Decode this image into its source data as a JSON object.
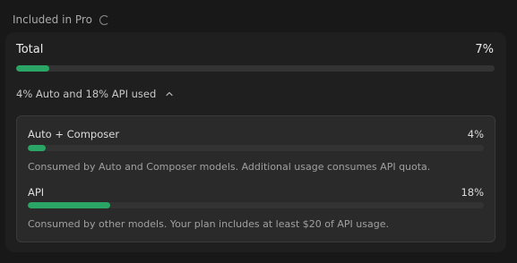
{
  "header": {
    "title": "Included in Pro"
  },
  "total": {
    "label": "Total",
    "percent_label": "7%",
    "progress": 0.07
  },
  "breakdown": {
    "toggle_label": "4% Auto and 18% API used",
    "expanded": true,
    "items": [
      {
        "label": "Auto + Composer",
        "percent_label": "4%",
        "progress": 0.04,
        "description": "Consumed by Auto and Composer models. Additional usage consumes API quota."
      },
      {
        "label": "API",
        "percent_label": "18%",
        "progress": 0.18,
        "description": "Consumed by other models. Your plan includes at least $20 of API usage."
      }
    ]
  },
  "colors": {
    "accent": "#2aa565",
    "track": "#333333",
    "background": "#181818",
    "card": "#1f1f1f",
    "panel": "#2a2a2a"
  },
  "icons": {
    "loading": "loading-spinner-icon",
    "toggle": "chevron-up-icon"
  }
}
